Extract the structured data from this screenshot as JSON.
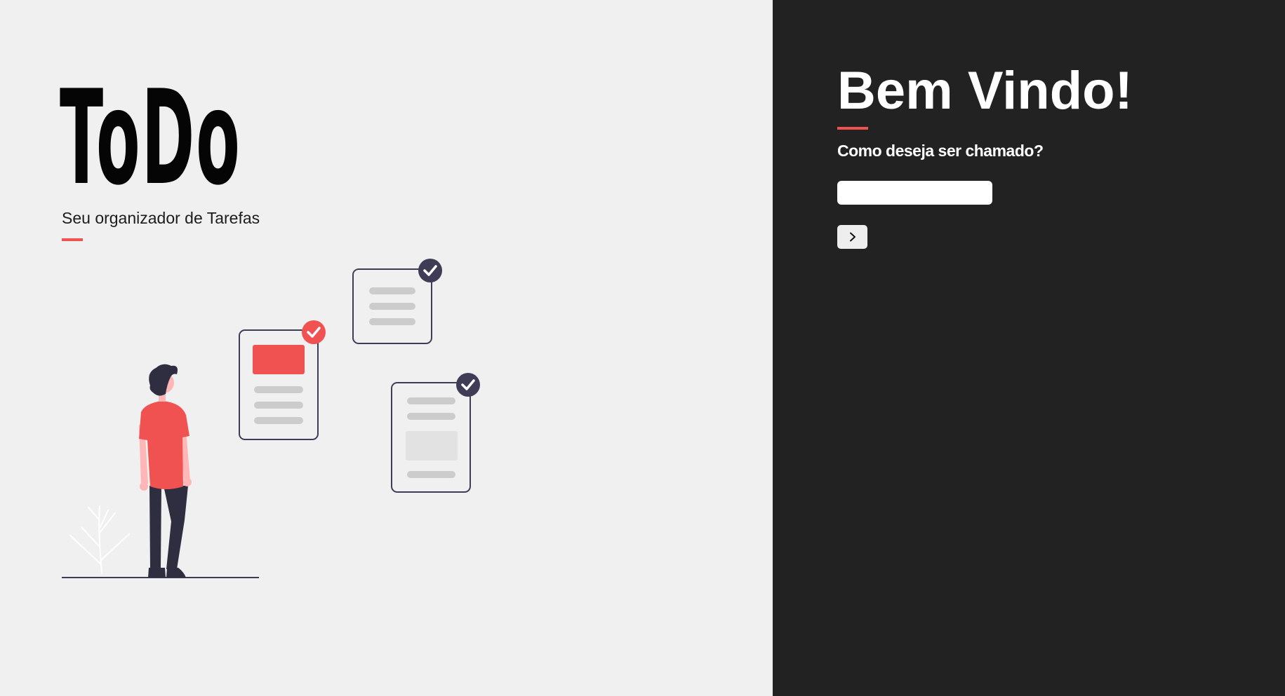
{
  "brand": {
    "logo": "ToDo",
    "tagline": "Seu organizador de Tarefas"
  },
  "welcome": {
    "heading": "Bem Vindo!",
    "question": "Como deseja ser chamado?",
    "name_input": {
      "value": "",
      "placeholder": ""
    },
    "submit_icon": "chevron-right-icon"
  },
  "colors": {
    "left_background": "#f0f0f0",
    "right_background": "#222222",
    "accent": "#f05252",
    "dark_ink": "#3f3d56"
  }
}
